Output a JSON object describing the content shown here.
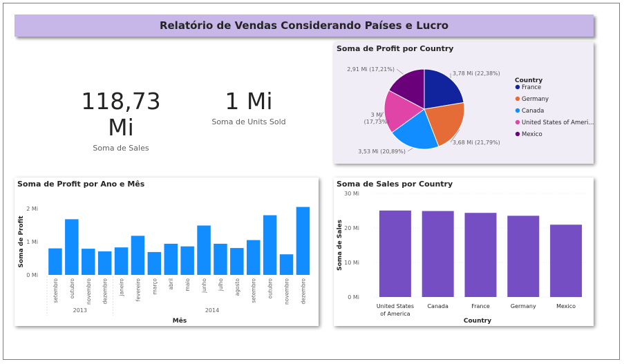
{
  "header": {
    "title": "Relatório de Vendas Considerando Países e Lucro"
  },
  "cards": [
    {
      "value": "118,73 Mi",
      "label": "Soma de  Sales"
    },
    {
      "value": "1 Mi",
      "label": "Soma de Units Sold"
    }
  ],
  "colors": {
    "bar_blue": "#118dff",
    "bar_purple": "#744ec2",
    "title_bg": "#c6b7e8",
    "pie_panel_bg": "#f0edf7"
  },
  "chart_data": [
    {
      "type": "pie",
      "title": "Soma de Profit por Country",
      "legend_title": "Country",
      "legend_position": "right",
      "slices": [
        {
          "name": "France",
          "value": 3.78,
          "label": "3,78 Mi (22,38%)",
          "color": "#12239e"
        },
        {
          "name": "Germany",
          "value": 3.68,
          "label": "3,68 Mi (21,79%)",
          "color": "#e66c37"
        },
        {
          "name": "Canada",
          "value": 3.53,
          "label": "3,53 Mi (20,89%)",
          "color": "#118dff"
        },
        {
          "name": "United States of Ameri...",
          "value": 3.0,
          "label": "3 Mi (17,73%)",
          "color": "#e044a7"
        },
        {
          "name": "Mexico",
          "value": 2.91,
          "label": "2,91 Mi (17,21%)",
          "color": "#6b007b"
        }
      ]
    },
    {
      "type": "bar",
      "title": "Soma de Profit por Ano e Mês",
      "xlabel": "Mês",
      "ylabel": "Soma de Profit",
      "ylim": [
        0,
        2
      ],
      "yticks": [
        "0 Mi",
        "1 Mi",
        "2 Mi"
      ],
      "categories": [
        "setembro",
        "outubro",
        "novembro",
        "dezembro",
        "janeiro",
        "fevereiro",
        "março",
        "abril",
        "maio",
        "junho",
        "julho",
        "agosto",
        "setembro",
        "outubro",
        "novembro",
        "dezembro"
      ],
      "groups": [
        {
          "label": "2013",
          "count": 4
        },
        {
          "label": "2014",
          "count": 12
        }
      ],
      "values": [
        0.8,
        1.68,
        0.79,
        0.71,
        0.83,
        1.18,
        0.69,
        0.94,
        0.86,
        1.49,
        0.94,
        0.81,
        1.05,
        1.8,
        0.62,
        2.05
      ]
    },
    {
      "type": "bar",
      "title": "Soma de Sales por Country",
      "xlabel": "Country",
      "ylabel": "Soma de Sales",
      "ylim": [
        0,
        30
      ],
      "yticks": [
        "0 Mi",
        "10 Mi",
        "20 Mi",
        "30 Mi"
      ],
      "categories": [
        "United States of America",
        "Canada",
        "France",
        "Germany",
        "Mexico"
      ],
      "category_lines": [
        [
          "United States",
          "of America"
        ],
        [
          "Canada"
        ],
        [
          "France"
        ],
        [
          "Germany"
        ],
        [
          "Mexico"
        ]
      ],
      "values": [
        25.03,
        24.89,
        24.35,
        23.51,
        20.95
      ]
    }
  ]
}
